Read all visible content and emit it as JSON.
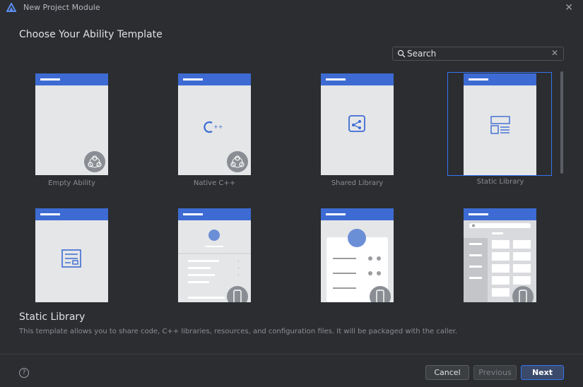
{
  "window": {
    "title": "New Project Module"
  },
  "heading": "Choose Your Ability Template",
  "search": {
    "placeholder": "Search"
  },
  "templates": [
    {
      "label": "Empty Ability",
      "icon": "ability-badge-icon"
    },
    {
      "label": "Native C++",
      "icon": "cpp-icon"
    },
    {
      "label": "Shared Library",
      "icon": "share-icon"
    },
    {
      "label": "Static Library",
      "icon": "static-library-icon",
      "selected": true
    },
    {
      "label": "",
      "icon": "form-icon"
    },
    {
      "label": "",
      "icon": "profile-list-icon"
    },
    {
      "label": "",
      "icon": "profile-card-icon"
    },
    {
      "label": "",
      "icon": "grid-list-icon"
    }
  ],
  "description": {
    "title": "Static Library",
    "text": "This template allows you to share code, C++ libraries, resources, and configuration files. It will be packaged with the caller."
  },
  "buttons": {
    "cancel": "Cancel",
    "previous": "Previous",
    "next": "Next"
  },
  "help": "?",
  "colors": {
    "accent": "#3574f0",
    "header_blue": "#3d6bd3",
    "background": "#2b2d30"
  }
}
